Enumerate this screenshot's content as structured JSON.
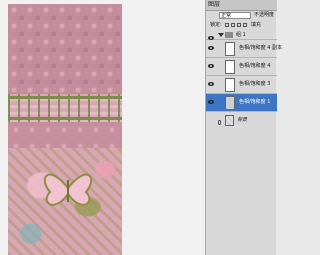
{
  "panel": {
    "tab_label": "图层",
    "blend_mode": "正常",
    "opacity_label": "不透明度",
    "lock_label": "锁定:",
    "fill_label": "填充"
  },
  "group": {
    "name": "组 1"
  },
  "layers": [
    {
      "name": "色相/饱和度 4 副本",
      "visible": true,
      "selected": false
    },
    {
      "name": "色相/饱和度 4",
      "visible": true,
      "selected": false
    },
    {
      "name": "色相/饱和度 3",
      "visible": true,
      "selected": false
    },
    {
      "name": "色相/饱和度 1",
      "visible": true,
      "selected": true
    }
  ],
  "background_layer": {
    "name": "背景"
  },
  "icons": {
    "eye": "eye-icon",
    "folder": "folder-icon",
    "lock": "lock-icon",
    "chain": "link-icon"
  },
  "colors": {
    "selection": "#3d74c4",
    "canvas_pink": "#c48d9c",
    "accent_green": "#7d8b48"
  }
}
